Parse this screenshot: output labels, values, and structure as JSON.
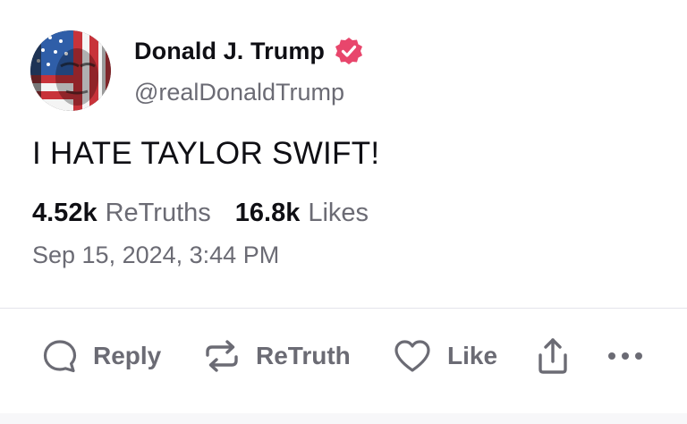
{
  "author": {
    "display_name": "Donald J. Trump",
    "handle": "@realDonaldTrump",
    "verified": true,
    "verified_color": "#e8466c"
  },
  "post": {
    "text": "I HATE TAYLOR SWIFT!",
    "retruths_count": "4.52k",
    "retruths_label": "ReTruths",
    "likes_count": "16.8k",
    "likes_label": "Likes",
    "timestamp": "Sep 15, 2024, 3:44 PM"
  },
  "actions": {
    "reply_label": "Reply",
    "retruth_label": "ReTruth",
    "like_label": "Like"
  },
  "icons": [
    "reply-icon",
    "retruth-icon",
    "like-icon",
    "share-icon",
    "more-icon",
    "verified-icon"
  ],
  "colors": {
    "text_primary": "#0f0f14",
    "text_secondary": "#6b6b74",
    "divider": "#e4e4ea"
  }
}
